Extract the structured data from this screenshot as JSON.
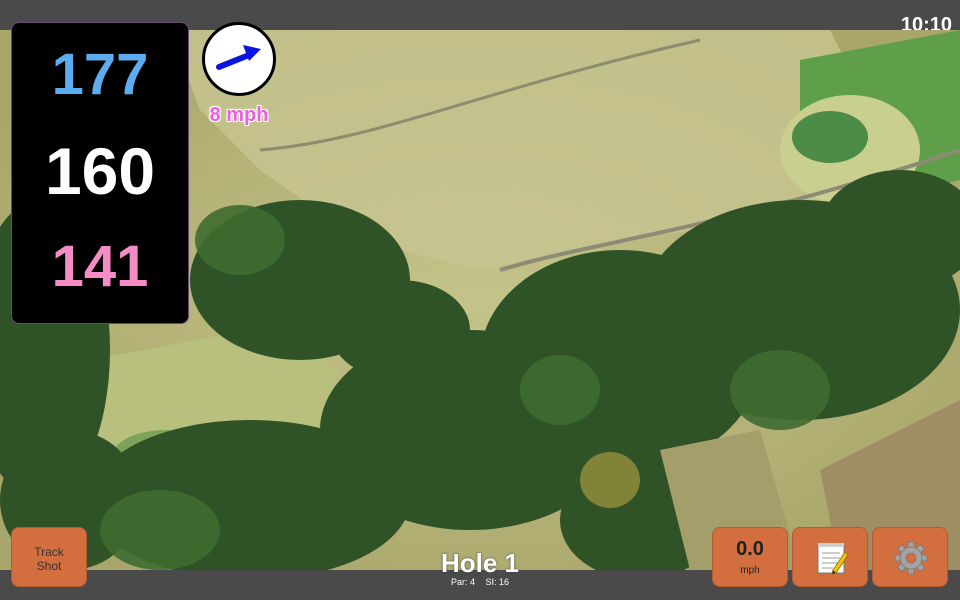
{
  "status_bar": {
    "clock": "10:10"
  },
  "distances": {
    "back": "177",
    "middle": "160",
    "front": "141"
  },
  "wind": {
    "speed_label": "8 mph",
    "icon": "arrow-icon",
    "color": "#0a14e0"
  },
  "buttons": {
    "track_shot_line1": "Track",
    "track_shot_line2": "Shot",
    "speed_value": "0.0",
    "speed_unit": "mph",
    "notes_icon": "notepad-icon",
    "settings_icon": "gear-icon"
  },
  "hole": {
    "title": "Hole 1",
    "par": "Par: 4",
    "si": "SI: 16"
  },
  "colors": {
    "back": "#5cacef",
    "middle": "#ffffff",
    "front": "#f58cc6",
    "button": "#d36e3f",
    "wind_text": "#ec5fe0"
  }
}
